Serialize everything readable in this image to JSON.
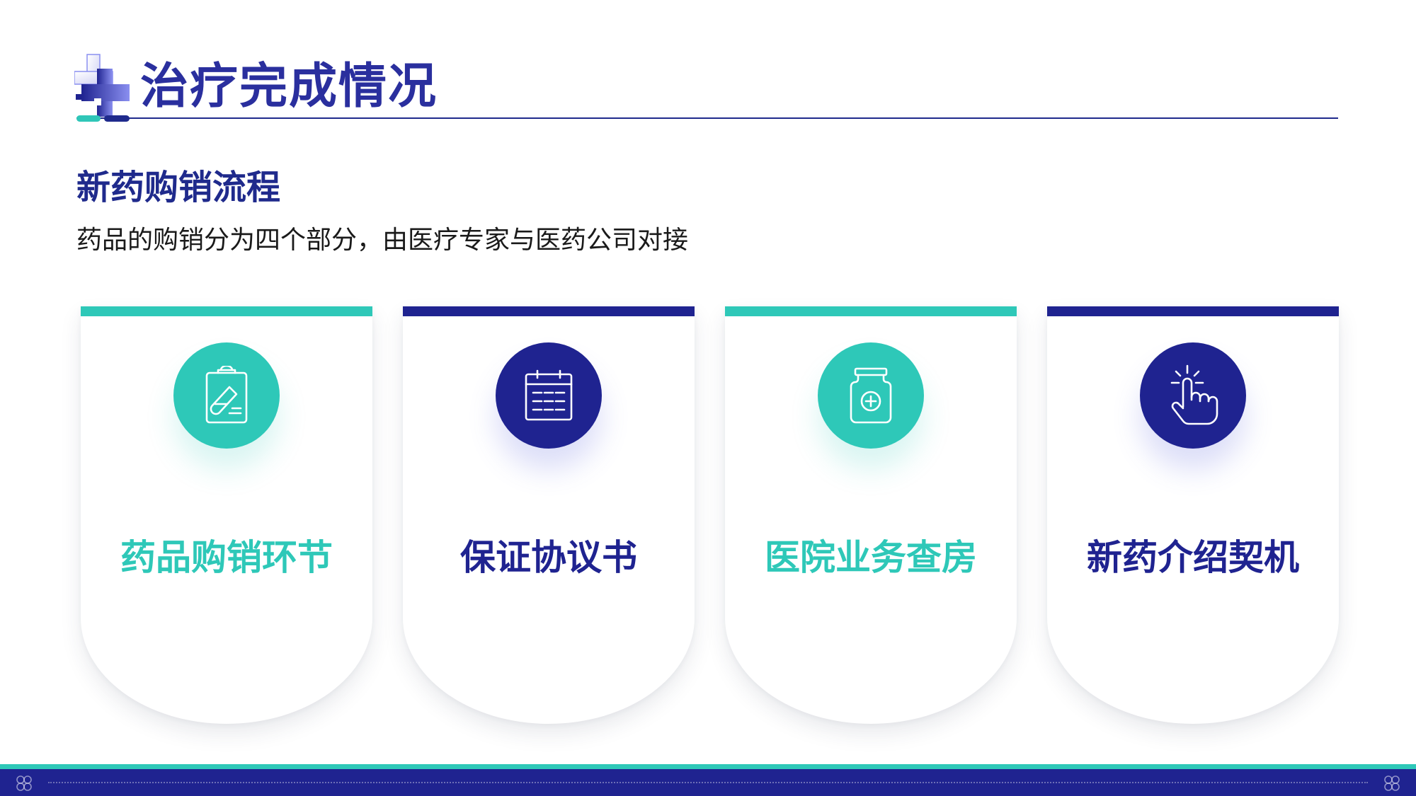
{
  "page": {
    "title": "治疗完成情况",
    "section_title": "新药购销流程",
    "section_desc": "药品的购销分为四个部分，由医疗专家与医药公司对接"
  },
  "colors": {
    "teal": "#2ec8b8",
    "navy": "#1f2390",
    "title_blue": "#2a2f9e"
  },
  "cards": [
    {
      "label": "药品购销环节",
      "icon": "clipboard-icon",
      "theme": "teal"
    },
    {
      "label": "保证协议书",
      "icon": "calendar-icon",
      "theme": "navy"
    },
    {
      "label": "医院业务查房",
      "icon": "medicine-jar-icon",
      "theme": "teal"
    },
    {
      "label": "新药介绍契机",
      "icon": "pointer-hand-icon",
      "theme": "navy"
    }
  ]
}
